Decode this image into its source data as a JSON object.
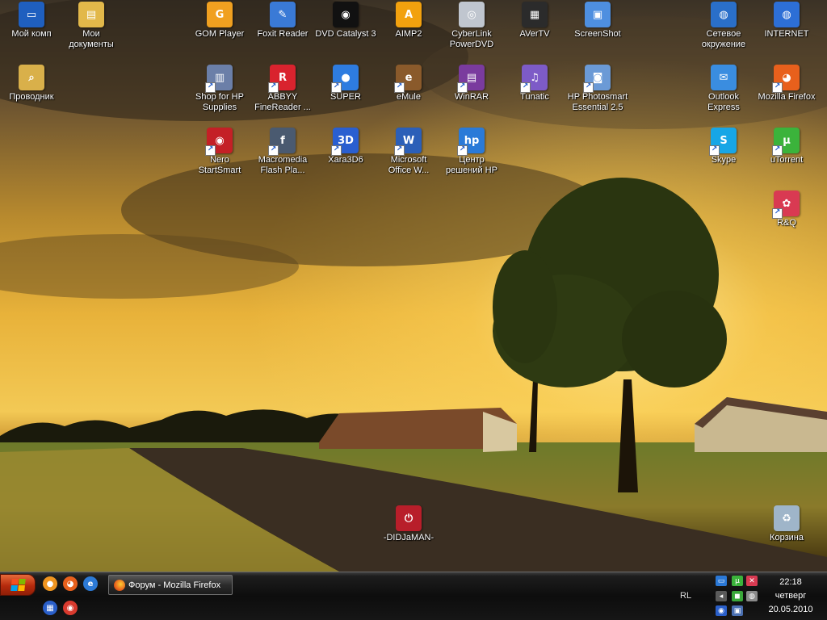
{
  "desktop": {
    "icons": [
      {
        "label": "Мой комп",
        "icon": "monitor-icon",
        "color": "#1f5fbf",
        "glyph": "▭",
        "shortcut": false
      },
      {
        "label": "Мои\nдокументы",
        "icon": "documents-folder-icon",
        "color": "#e2b84a",
        "glyph": "▤",
        "shortcut": false
      },
      {
        "label": "GOM Player",
        "icon": "gom-player-icon",
        "color": "#f0a020",
        "glyph": "G",
        "shortcut": false
      },
      {
        "label": "Foxit Reader",
        "icon": "foxit-reader-icon",
        "color": "#3a7ad6",
        "glyph": "✎",
        "shortcut": false
      },
      {
        "label": "DVD Catalyst 3",
        "icon": "dvd-catalyst-icon",
        "color": "#111111",
        "glyph": "◉",
        "shortcut": false
      },
      {
        "label": "AIMP2",
        "icon": "aimp2-icon",
        "color": "#f2a10e",
        "glyph": "A",
        "shortcut": false
      },
      {
        "label": "CyberLink\nPowerDVD",
        "icon": "powerdvd-icon",
        "color": "#c0c6cf",
        "glyph": "◎",
        "shortcut": false
      },
      {
        "label": "AVerTV",
        "icon": "avertv-icon",
        "color": "#2b2b2b",
        "glyph": "▦",
        "shortcut": false
      },
      {
        "label": "ScreenShot",
        "icon": "screenshot-icon",
        "color": "#4e8fe0",
        "glyph": "▣",
        "shortcut": false
      },
      {
        "label": "Сетевое\nокружение",
        "icon": "network-icon",
        "color": "#2a6fc9",
        "glyph": "◍",
        "shortcut": false
      },
      {
        "label": "INTERNET",
        "icon": "internet-icon",
        "color": "#2d6fd6",
        "glyph": "◍",
        "shortcut": false
      },
      {
        "label": "Проводник",
        "icon": "explorer-icon",
        "color": "#d9b04a",
        "glyph": "⌕",
        "shortcut": false
      },
      {
        "label": "Shop for HP\nSupplies",
        "icon": "hp-supplies-icon",
        "color": "#6b7fa8",
        "glyph": "▥",
        "shortcut": true
      },
      {
        "label": "ABBYY\nFineReader ...",
        "icon": "abbyy-finereader-icon",
        "color": "#d9232e",
        "glyph": "R",
        "shortcut": true
      },
      {
        "label": "SUPER",
        "icon": "super-icon",
        "color": "#2e7ce0",
        "glyph": "●",
        "shortcut": true
      },
      {
        "label": "eMule",
        "icon": "emule-icon",
        "color": "#8a5a2b",
        "glyph": "e",
        "shortcut": true
      },
      {
        "label": "WinRAR",
        "icon": "winrar-icon",
        "color": "#7a3b9e",
        "glyph": "▤",
        "shortcut": true
      },
      {
        "label": "Tunatic",
        "icon": "tunatic-icon",
        "color": "#7d5bc7",
        "glyph": "♫",
        "shortcut": true
      },
      {
        "label": "HP Photosmart\nEssential 2.5",
        "icon": "hp-photosmart-icon",
        "color": "#6b9ad6",
        "glyph": "◙",
        "shortcut": true
      },
      {
        "label": "Outlook\nExpress",
        "icon": "outlook-express-icon",
        "color": "#3a8de0",
        "glyph": "✉",
        "shortcut": false
      },
      {
        "label": "Mozilla Firefox",
        "icon": "firefox-icon",
        "color": "#e8601c",
        "glyph": "◕",
        "shortcut": true
      },
      {
        "label": "Nero\nStartSmart",
        "icon": "nero-icon",
        "color": "#c42026",
        "glyph": "◉",
        "shortcut": true
      },
      {
        "label": "Macromedia\nFlash Pla...",
        "icon": "flash-player-icon",
        "color": "#4a5a70",
        "glyph": "f",
        "shortcut": true
      },
      {
        "label": "Xara3D6",
        "icon": "xara3d-icon",
        "color": "#2a5fd0",
        "glyph": "3D",
        "shortcut": true
      },
      {
        "label": "Microsoft\nOffice W...",
        "icon": "word-icon",
        "color": "#2b5fb8",
        "glyph": "W",
        "shortcut": true
      },
      {
        "label": "Центр\nрешений HP",
        "icon": "hp-solution-center-icon",
        "color": "#2a7ad8",
        "glyph": "hp",
        "shortcut": true
      },
      {
        "label": "Skype",
        "icon": "skype-icon",
        "color": "#17a6e6",
        "glyph": "S",
        "shortcut": true
      },
      {
        "label": "uTorrent",
        "icon": "utorrent-icon",
        "color": "#3bb33b",
        "glyph": "µ",
        "shortcut": true
      },
      {
        "label": "R&Q",
        "icon": "rnq-icon",
        "color": "#d93a52",
        "glyph": "✿",
        "shortcut": true
      },
      {
        "label": "-DIDJaMAN-",
        "icon": "shutdown-icon",
        "color": "#b81e2a",
        "glyph": "⏻",
        "shortcut": false
      },
      {
        "label": "Корзина",
        "icon": "recycle-bin-icon",
        "color": "#9fb5c9",
        "glyph": "♻",
        "shortcut": false
      }
    ]
  },
  "taskbar": {
    "start_flag_colors": [
      "#f25022",
      "#7fba00",
      "#00a4ef",
      "#ffb900"
    ],
    "quick_launch": [
      {
        "icon": "quicklaunch-orange-icon",
        "color": "#f09520",
        "glyph": "●"
      },
      {
        "icon": "quicklaunch-firefox-icon",
        "color": "#e8601c",
        "glyph": "◕"
      },
      {
        "icon": "quicklaunch-ie-icon",
        "color": "#2c7ad6",
        "glyph": "e"
      },
      {
        "icon": "quicklaunch-blue-icon",
        "color": "#2a5fc9",
        "glyph": "▦"
      },
      {
        "icon": "quicklaunch-red-icon",
        "color": "#d93a2e",
        "glyph": "◉"
      }
    ],
    "task_button_label": "Форум - Mozilla Firefox",
    "language": "RL",
    "tray_icons": [
      {
        "icon": "tray-network-icon",
        "color": "#2a78d6",
        "glyph": "▭"
      },
      {
        "icon": "tray-utorrent-icon",
        "color": "#3bb33b",
        "glyph": "µ"
      },
      {
        "icon": "tray-rnq-icon",
        "color": "#d93a52",
        "glyph": "✕"
      },
      {
        "icon": "tray-volume-icon",
        "color": "#5a5a5a",
        "glyph": "◂"
      },
      {
        "icon": "tray-green-icon",
        "color": "#3aa83a",
        "glyph": "◼"
      },
      {
        "icon": "tray-gray-icon",
        "color": "#8a8a8a",
        "glyph": "◍"
      },
      {
        "icon": "tray-blue-icon",
        "color": "#2a5fc9",
        "glyph": "◉"
      },
      {
        "icon": "tray-safely-remove-icon",
        "color": "#4a6fb0",
        "glyph": "▣"
      }
    ],
    "clock": {
      "time": "22:18",
      "day": "четверг",
      "date": "20.05.2010"
    }
  }
}
